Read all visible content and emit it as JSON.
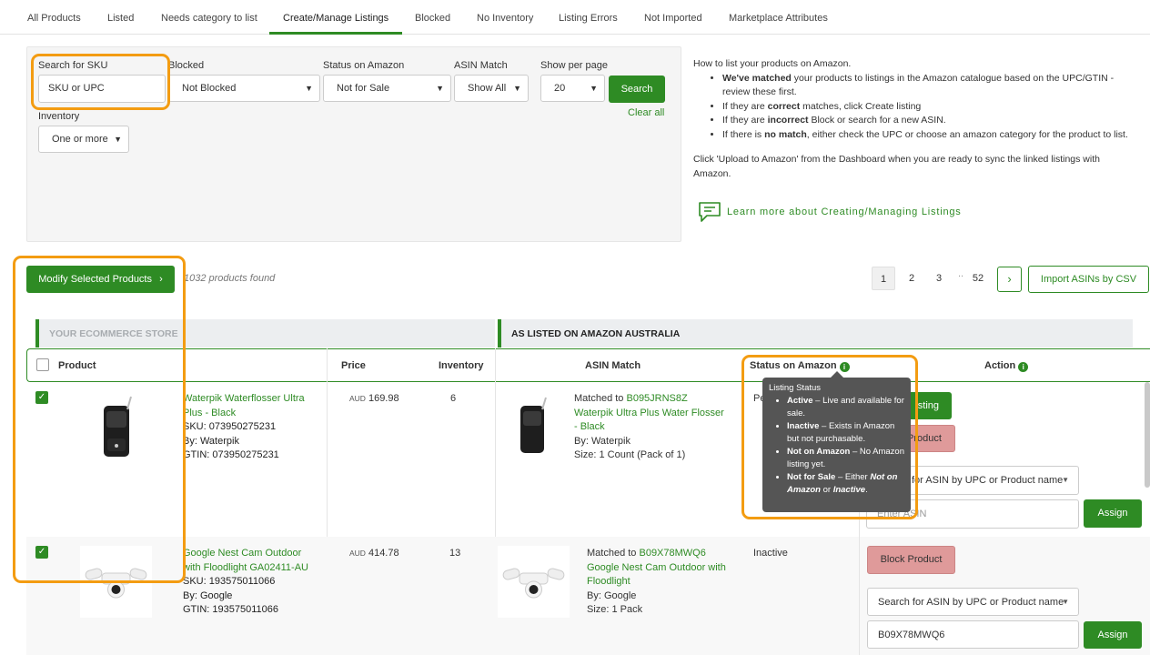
{
  "tabs": [
    "All Products",
    "Listed",
    "Needs category to list",
    "Create/Manage Listings",
    "Blocked",
    "No Inventory",
    "Listing Errors",
    "Not Imported",
    "Marketplace Attributes"
  ],
  "filters": {
    "sku_label": "Search for SKU",
    "sku_value": "SKU or UPC",
    "blocked_label": "Blocked",
    "blocked_value": "Not Blocked",
    "status_label": "Status on Amazon",
    "status_value": "Not for Sale",
    "asin_label": "ASIN Match",
    "asin_value": "Show All",
    "perpage_label": "Show per page",
    "perpage_value": "20",
    "search_button": "Search",
    "clear_all": "Clear all",
    "inventory_label": "Inventory",
    "inventory_value": "One or more"
  },
  "help": {
    "title": "How to list your products on Amazon.",
    "b1_bold": "We've matched",
    "b1_rest": " your products to listings in the Amazon catalogue based on the UPC/GTIN - review these first.",
    "b2_pre": "If they are ",
    "b2_bold": "correct",
    "b2_rest": " matches, click Create listing",
    "b3_pre": "If they are ",
    "b3_bold": "incorrect",
    "b3_rest": " Block or search for a new ASIN.",
    "b4_pre": "If there is ",
    "b4_bold": "no match",
    "b4_rest": ", either check the UPC or choose an amazon category for the product to list.",
    "upload_note": "Click 'Upload to Amazon' from the Dashboard when you are ready to sync the linked listings with Amazon.",
    "learn_more": "Learn more about Creating/Managing Listings"
  },
  "toolbar": {
    "modify_button": "Modify Selected Products",
    "found": "1032 products found",
    "pages": [
      "1",
      "2",
      "3",
      "..",
      "52"
    ],
    "next": "›",
    "import_button": "Import ASINs by CSV"
  },
  "sections": {
    "left": "YOUR ECOMMERCE STORE",
    "right": "AS LISTED ON AMAZON AUSTRALIA"
  },
  "columns": {
    "product": "Product",
    "price": "Price",
    "inventory": "Inventory",
    "asin_match": "ASIN Match",
    "status": "Status on Amazon",
    "action": "Action"
  },
  "rows": [
    {
      "name": "Waterpik Waterflosser Ultra Plus - Black",
      "sku": "SKU: 073950275231",
      "by": "By: Waterpik",
      "gtin": "GTIN: 073950275231",
      "currency": "AUD",
      "price": "169.98",
      "inventory": "6",
      "matched_prefix": "Matched to ",
      "asin": "B095JRNS8Z",
      "asin_title": "Waterpik Ultra Plus Water Flosser - Black",
      "asin_by": "By: Waterpik",
      "asin_size": "Size: 1 Count (Pack of 1)",
      "status": "Pend",
      "create_button": "Create Listing",
      "create_visible": "isting",
      "block_button": "Block Product",
      "search_select": "Search for ASIN by UPC or Product name",
      "search_visible": "for ASIN by UPC or Product name",
      "asin_input_placeholder": "Enter ASIN",
      "asin_input_visible": "Enter ASIN",
      "assign_button": "Assign"
    },
    {
      "name": "Google Nest Cam Outdoor with Floodlight GA02411-AU",
      "sku": "SKU: 193575011066",
      "by": "By: Google",
      "gtin": "GTIN: 193575011066",
      "currency": "AUD",
      "price": "414.78",
      "inventory": "13",
      "matched_prefix": "Matched to ",
      "asin": "B09X78MWQ6",
      "asin_title": "Google Nest Cam Outdoor with Floodlight",
      "asin_by": "By: Google",
      "asin_size": "Size: 1 Pack",
      "status": "Inactive",
      "block_button": "Block Product",
      "search_select": "Search for ASIN by UPC or Product name",
      "asin_input_value": "B09X78MWQ6",
      "assign_button": "Assign"
    }
  ],
  "tooltip": {
    "title": "Listing Status",
    "i1_bold": "Active",
    "i1_rest": " – Live and available for sale.",
    "i2_bold": "Inactive",
    "i2_rest": " – Exists in Amazon but not purchasable.",
    "i3_bold": "Not on Amazon",
    "i3_rest": " – No Amazon listing yet.",
    "i4_bold": "Not for Sale",
    "i4_mid": " – Either ",
    "i4_em1": "Not on Amazon",
    "i4_or": " or ",
    "i4_em2": "Inactive",
    "i4_end": "."
  },
  "colors": {
    "accent": "#2e8b24",
    "highlight": "#f39c12",
    "block_button": "#df9a9a",
    "tooltip_bg": "#555555"
  }
}
